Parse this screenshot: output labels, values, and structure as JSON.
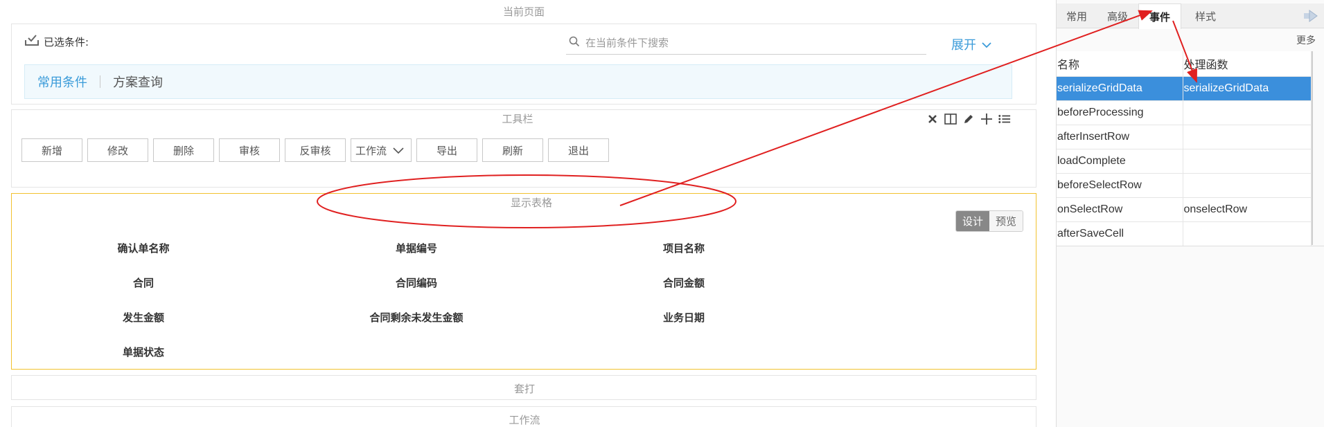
{
  "sections": {
    "current_page": "当前页面",
    "toolbar": "工具栏",
    "grid": "显示表格",
    "print": "套打",
    "workflow": "工作流"
  },
  "conditions": {
    "label": "已选条件:",
    "search_placeholder": "在当前条件下搜索",
    "expand_label": "展开",
    "tabs": [
      {
        "label": "常用条件",
        "active": true
      },
      {
        "label": "方案查询",
        "active": false
      }
    ]
  },
  "toolbar": {
    "buttons": [
      "新增",
      "修改",
      "删除",
      "审核",
      "反审核",
      "工作流",
      "导出",
      "刷新",
      "退出"
    ],
    "icons": [
      "close-icon",
      "columns-icon",
      "pencil-icon",
      "plus-icon",
      "list-icon"
    ]
  },
  "grid": {
    "mode_design": "设计",
    "mode_preview": "预览",
    "fields": [
      [
        "确认单名称",
        "单据编号",
        "项目名称"
      ],
      [
        "合同",
        "合同编码",
        "合同金额"
      ],
      [
        "发生金额",
        "合同剩余未发生金额",
        "业务日期"
      ],
      [
        "单据状态"
      ]
    ]
  },
  "properties": {
    "tabs": [
      "常用",
      "高级",
      "事件",
      "样式"
    ],
    "active_tab": "事件",
    "more_label": "更多",
    "columns": [
      "名称",
      "处理函数"
    ],
    "rows": [
      {
        "name": "serializeGridData",
        "handler": "serializeGridData",
        "selected": true
      },
      {
        "name": "beforeProcessing",
        "handler": ""
      },
      {
        "name": "afterInsertRow",
        "handler": ""
      },
      {
        "name": "loadComplete",
        "handler": ""
      },
      {
        "name": "beforeSelectRow",
        "handler": ""
      },
      {
        "name": "onSelectRow",
        "handler": "onselectRow"
      },
      {
        "name": "afterSaveCell",
        "handler": ""
      }
    ]
  },
  "colors": {
    "accent": "#3a9bd9",
    "selected_row": "#3b8fdc",
    "grid_border": "#f2c22e",
    "annotation": "#e02020"
  }
}
